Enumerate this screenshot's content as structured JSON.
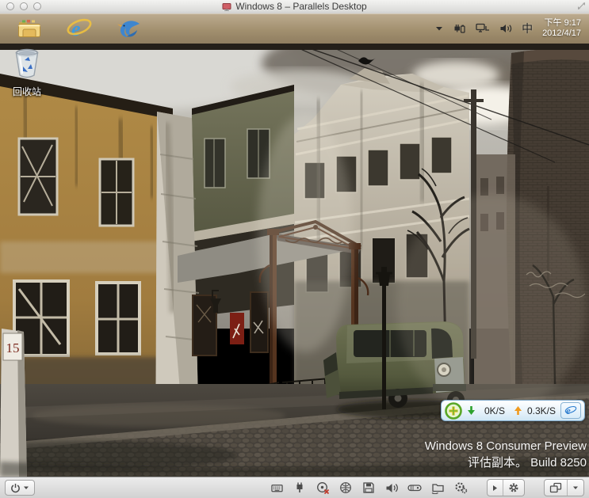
{
  "window": {
    "title": "Windows 8 – Parallels Desktop"
  },
  "taskbar": {
    "apps": [
      {
        "icon": "file-explorer"
      },
      {
        "icon": "internet-explorer"
      },
      {
        "icon": "thunderbird"
      }
    ],
    "tray": {
      "icons": [
        "hidden-icons-chevron",
        "power-battery",
        "network",
        "volume"
      ],
      "ime": "中",
      "time": "下午 9:17",
      "date": "2012/4/17"
    }
  },
  "desktop": {
    "recycle_bin_label": "回收站",
    "address_sign": "15",
    "watermark": {
      "line1": "Windows 8 Consumer Preview",
      "line2": "评估副本。 Build 8250"
    }
  },
  "net_widget": {
    "icons": [
      "360-safe",
      "download-arrow",
      "upload-arrow",
      "internet-explorer"
    ],
    "down_speed": "0K/S",
    "up_speed": "0.3K/S"
  },
  "statusbar": {
    "device_icons": [
      "keyboard",
      "usb",
      "cd-dvd-disconnected",
      "network",
      "floppy",
      "sound",
      "hard-disk",
      "shared-folders",
      "shared-applications"
    ],
    "buttons": [
      "power",
      "expand",
      "settings",
      "view-mode",
      "view-dropdown"
    ]
  },
  "colors": {
    "taskbar_tan": "#a2906f",
    "titlebar_grey": "#e9e9e7",
    "statusbar_grey": "#dedede",
    "widget_border": "#7fa9c9",
    "watermark_text": "#ffffff",
    "ie_blue": "#2f7fd0",
    "arrow_down_green": "#2da12d",
    "arrow_up_orange": "#f09a1e"
  }
}
